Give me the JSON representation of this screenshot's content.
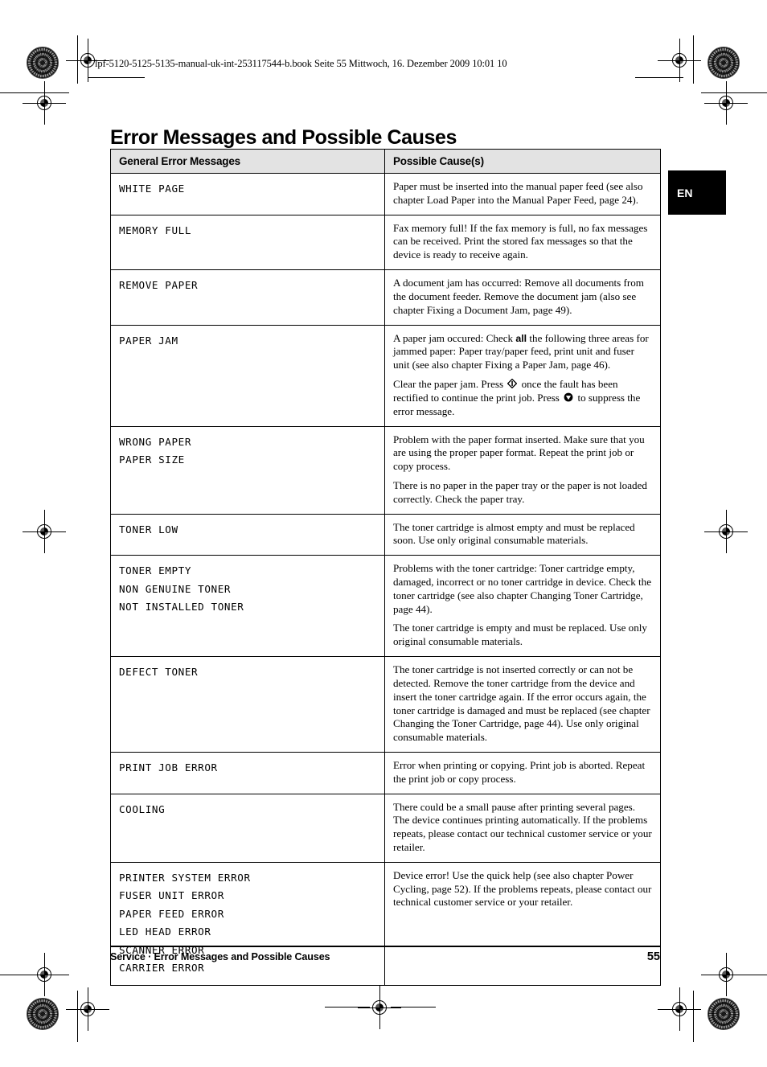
{
  "print_meta": {
    "running_head": "lpf-5120-5125-5135-manual-uk-int-253117544-b.book  Seite 55  Mittwoch, 16. Dezember 2009  10:01 10"
  },
  "page": {
    "title": "Error Messages and Possible Causes",
    "language_tab": "EN"
  },
  "table": {
    "headers": {
      "col_code": "General Error Messages",
      "col_cause": "Possible Cause(s)"
    },
    "rows": [
      {
        "codes": [
          "WHITE PAGE"
        ],
        "paragraphs": [
          "Paper must be inserted into the manual paper feed (see also chapter Load Paper into the Manual Paper Feed, page 24)."
        ]
      },
      {
        "codes": [
          "MEMORY FULL"
        ],
        "paragraphs": [
          "Fax memory full! If the fax memory is full, no fax messages can be received. Print the stored fax messages so that the device is ready to receive again."
        ]
      },
      {
        "codes": [
          "REMOVE PAPER"
        ],
        "paragraphs": [
          "A document jam has occurred: Remove all documents from the document feeder. Remove the document jam (also see chapter Fixing a Document Jam, page 49)."
        ]
      },
      {
        "codes": [
          "PAPER JAM"
        ],
        "paragraphs": [],
        "rich": {
          "p1_a": "A paper jam occured: Check ",
          "p1_bold": "all",
          "p1_b": " the following three areas for jammed paper: Paper tray/paper feed, print unit and fuser unit (see also chapter Fixing a Paper Jam, page 46).",
          "p2_a": "Clear the paper jam. Press ",
          "p2_key1": "ok-key-icon",
          "p2_b": " once the fault has been rectified to continue the print job.  Press ",
          "p2_key2": "stop-key-icon",
          "p2_c": " to suppress the error message."
        }
      },
      {
        "codes": [
          "WRONG PAPER",
          "PAPER SIZE"
        ],
        "paragraphs": [
          "Problem with the paper format inserted. Make sure that you are using the proper paper format. Repeat the print job or copy process.",
          "There is no paper in the paper tray or the paper is not loaded correctly. Check the paper tray."
        ]
      },
      {
        "codes": [
          "TONER LOW"
        ],
        "paragraphs": [
          "The toner cartridge is almost empty and must be replaced soon. Use only original consumable materials."
        ]
      },
      {
        "codes": [
          "TONER EMPTY",
          "NON GENUINE TONER",
          "NOT INSTALLED TONER"
        ],
        "paragraphs": [
          "Problems with the toner cartridge: Toner cartridge empty, damaged, incorrect or no toner cartridge in device. Check the toner cartridge (see also chapter Changing Toner Cartridge, page 44).",
          "The toner cartridge is empty and must be replaced. Use only original consumable materials."
        ]
      },
      {
        "codes": [
          "DEFECT TONER"
        ],
        "paragraphs": [
          "The toner cartridge is not inserted correctly or can not be detected. Remove the toner cartridge from the device and insert the toner cartridge again. If the error occurs again, the toner cartridge is damaged and must be replaced (see chapter Changing the Toner Cartridge, page 44). Use only original consumable materials."
        ]
      },
      {
        "codes": [
          "PRINT JOB ERROR"
        ],
        "paragraphs": [
          "Error when printing or copying. Print job is aborted. Repeat the print job or copy process."
        ]
      },
      {
        "codes": [
          "COOLING"
        ],
        "paragraphs": [
          "There could be a small pause after printing several pages. The device continues printing automatically. If the problems repeats, please contact our technical customer service or your retailer."
        ]
      },
      {
        "codes": [
          "PRINTER SYSTEM ERROR",
          "FUSER UNIT ERROR",
          "PAPER FEED ERROR",
          "LED HEAD ERROR",
          "SCANNER ERROR",
          "CARRIER ERROR"
        ],
        "paragraphs": [
          "Device error! Use the quick help (see also chapter Power Cycling, page 52). If the problems repeats, please contact our technical customer service or your retailer."
        ]
      }
    ]
  },
  "footer": {
    "left": "Service · Error Messages and Possible Causes",
    "page_number": "55"
  }
}
